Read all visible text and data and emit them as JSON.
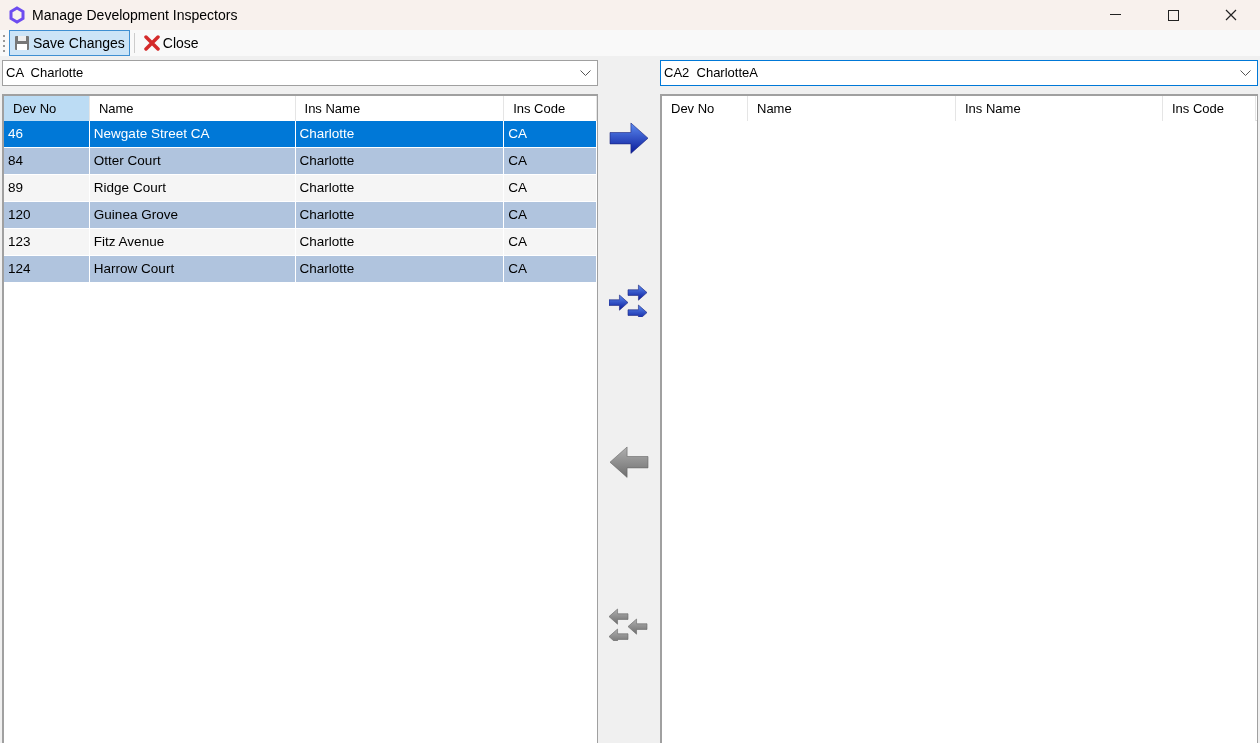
{
  "window": {
    "title": "Manage Development Inspectors"
  },
  "toolbar": [
    {
      "kind": "save",
      "label": "Save Changes",
      "pressed": true
    },
    {
      "kind": "close",
      "label": "Close",
      "pressed": false
    }
  ],
  "left": {
    "combo": {
      "value": "CA  Charlotte",
      "focused": false
    },
    "columns": [
      {
        "label": "Dev No",
        "highlighted": true
      },
      {
        "label": "Name",
        "highlighted": false
      },
      {
        "label": "Ins Name",
        "highlighted": false
      },
      {
        "label": "Ins Code",
        "highlighted": false
      }
    ],
    "rows": [
      {
        "cells": [
          "46",
          "Newgate Street CA",
          "Charlotte",
          "CA"
        ],
        "selected": true
      },
      {
        "cells": [
          "84",
          "Otter Court",
          "Charlotte",
          "CA"
        ],
        "selected": false
      },
      {
        "cells": [
          "89",
          "Ridge Court",
          "Charlotte",
          "CA"
        ],
        "selected": false
      },
      {
        "cells": [
          "120",
          "Guinea Grove",
          "Charlotte",
          "CA"
        ],
        "selected": false
      },
      {
        "cells": [
          "123",
          "Fitz Avenue",
          "Charlotte",
          "CA"
        ],
        "selected": false
      },
      {
        "cells": [
          "124",
          "Harrow Court",
          "Charlotte",
          "CA"
        ],
        "selected": false
      }
    ]
  },
  "move_buttons": [
    {
      "kind": "right",
      "disabled": false
    },
    {
      "kind": "all_right",
      "disabled": false
    },
    {
      "kind": "left",
      "disabled": true
    },
    {
      "kind": "all_left",
      "disabled": true
    }
  ],
  "right": {
    "combo": {
      "value": "CA2  CharlotteA",
      "focused": true
    },
    "columns": [
      {
        "label": "Dev No",
        "highlighted": false
      },
      {
        "label": "Name",
        "highlighted": false
      },
      {
        "label": "Ins Name",
        "highlighted": false
      },
      {
        "label": "Ins Code",
        "highlighted": false
      }
    ]
  }
}
